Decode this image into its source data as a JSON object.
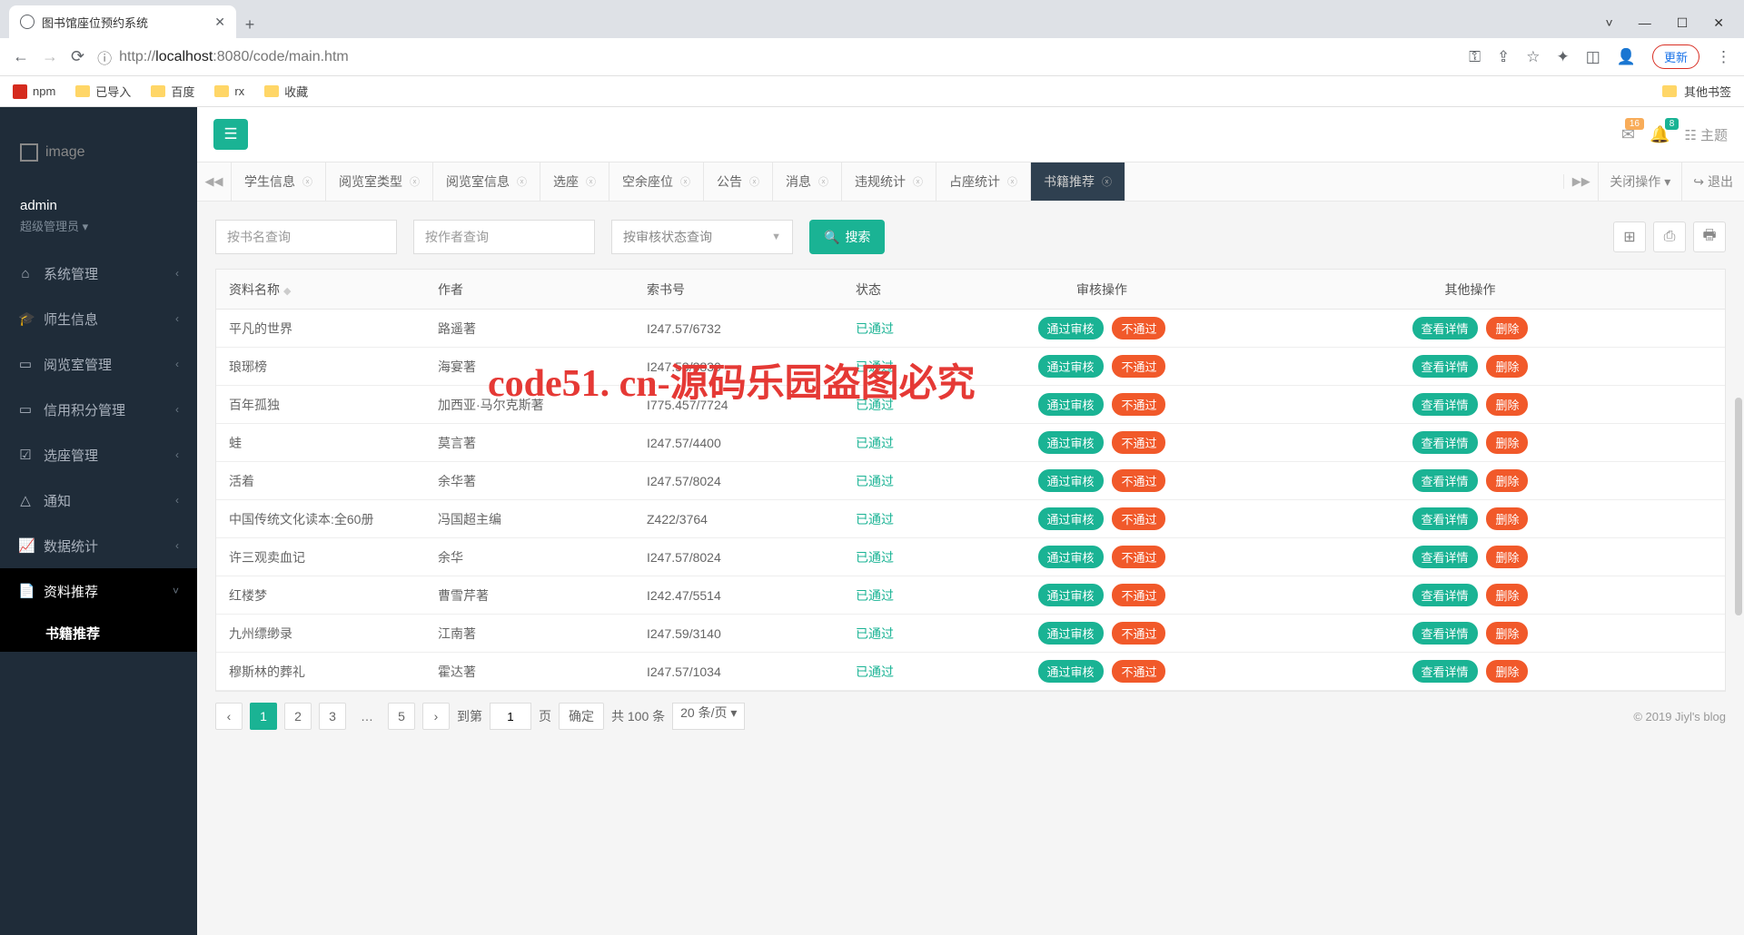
{
  "browser": {
    "tab_title": "图书馆座位预约系统",
    "url_prefix": "http://",
    "url_host": "localhost",
    "url_port_path": ":8080/code/main.htm",
    "update": "更新",
    "bookmarks": [
      "npm",
      "已导入",
      "百度",
      "rx",
      "收藏"
    ],
    "other_bookmarks": "其他书签"
  },
  "sidebar": {
    "logo": "image",
    "user": "admin",
    "role": "超级管理员",
    "menu": [
      {
        "icon": "⌂",
        "label": "系统管理"
      },
      {
        "icon": "🎓",
        "label": "师生信息"
      },
      {
        "icon": "▭",
        "label": "阅览室管理"
      },
      {
        "icon": "▭",
        "label": "信用积分管理"
      },
      {
        "icon": "☑",
        "label": "选座管理"
      },
      {
        "icon": "△",
        "label": "通知"
      },
      {
        "icon": "📈",
        "label": "数据统计"
      },
      {
        "icon": "📄",
        "label": "资料推荐"
      }
    ],
    "submenu": "书籍推荐"
  },
  "topbar": {
    "notif1": "16",
    "notif2": "8",
    "theme": "主题"
  },
  "tabs": {
    "items": [
      "学生信息",
      "阅览室类型",
      "阅览室信息",
      "选座",
      "空余座位",
      "公告",
      "消息",
      "违规统计",
      "占座统计",
      "书籍推荐"
    ],
    "close_ops": "关闭操作",
    "logout": "退出"
  },
  "filters": {
    "by_name": "按书名查询",
    "by_author": "按作者查询",
    "by_status": "按审核状态查询",
    "search": "搜索"
  },
  "table": {
    "headers": [
      "资料名称",
      "作者",
      "索书号",
      "状态",
      "审核操作",
      "其他操作"
    ],
    "approve": "通过审核",
    "reject": "不通过",
    "detail": "查看详情",
    "delete": "删除",
    "status_pass": "已通过",
    "rows": [
      {
        "name": "平凡的世界",
        "author": "路遥著",
        "code": "I247.57/6732"
      },
      {
        "name": "琅琊榜",
        "author": "海宴著",
        "code": "I247.53/3830"
      },
      {
        "name": "百年孤独",
        "author": "加西亚·马尔克斯著",
        "code": "I775.457/7724"
      },
      {
        "name": "蛙",
        "author": "莫言著",
        "code": "I247.57/4400"
      },
      {
        "name": "活着",
        "author": "余华著",
        "code": "I247.57/8024"
      },
      {
        "name": "中国传统文化读本:全60册",
        "author": "冯国超主编",
        "code": "Z422/3764"
      },
      {
        "name": "许三观卖血记",
        "author": "余华",
        "code": "I247.57/8024"
      },
      {
        "name": "红楼梦",
        "author": "曹雪芹著",
        "code": "I242.47/5514"
      },
      {
        "name": "九州缥缈录",
        "author": "江南著",
        "code": "I247.59/3140"
      },
      {
        "name": "穆斯林的葬礼",
        "author": "霍达著",
        "code": "I247.57/1034"
      }
    ]
  },
  "pagination": {
    "pages": [
      "1",
      "2",
      "3",
      "…",
      "5"
    ],
    "goto": "到第",
    "page": "页",
    "confirm": "确定",
    "total": "共 100 条",
    "per": "20 条/页",
    "input": "1"
  },
  "footer": "© 2019 Jiyl's blog",
  "watermark": "code51. cn-源码乐园盗图必究"
}
